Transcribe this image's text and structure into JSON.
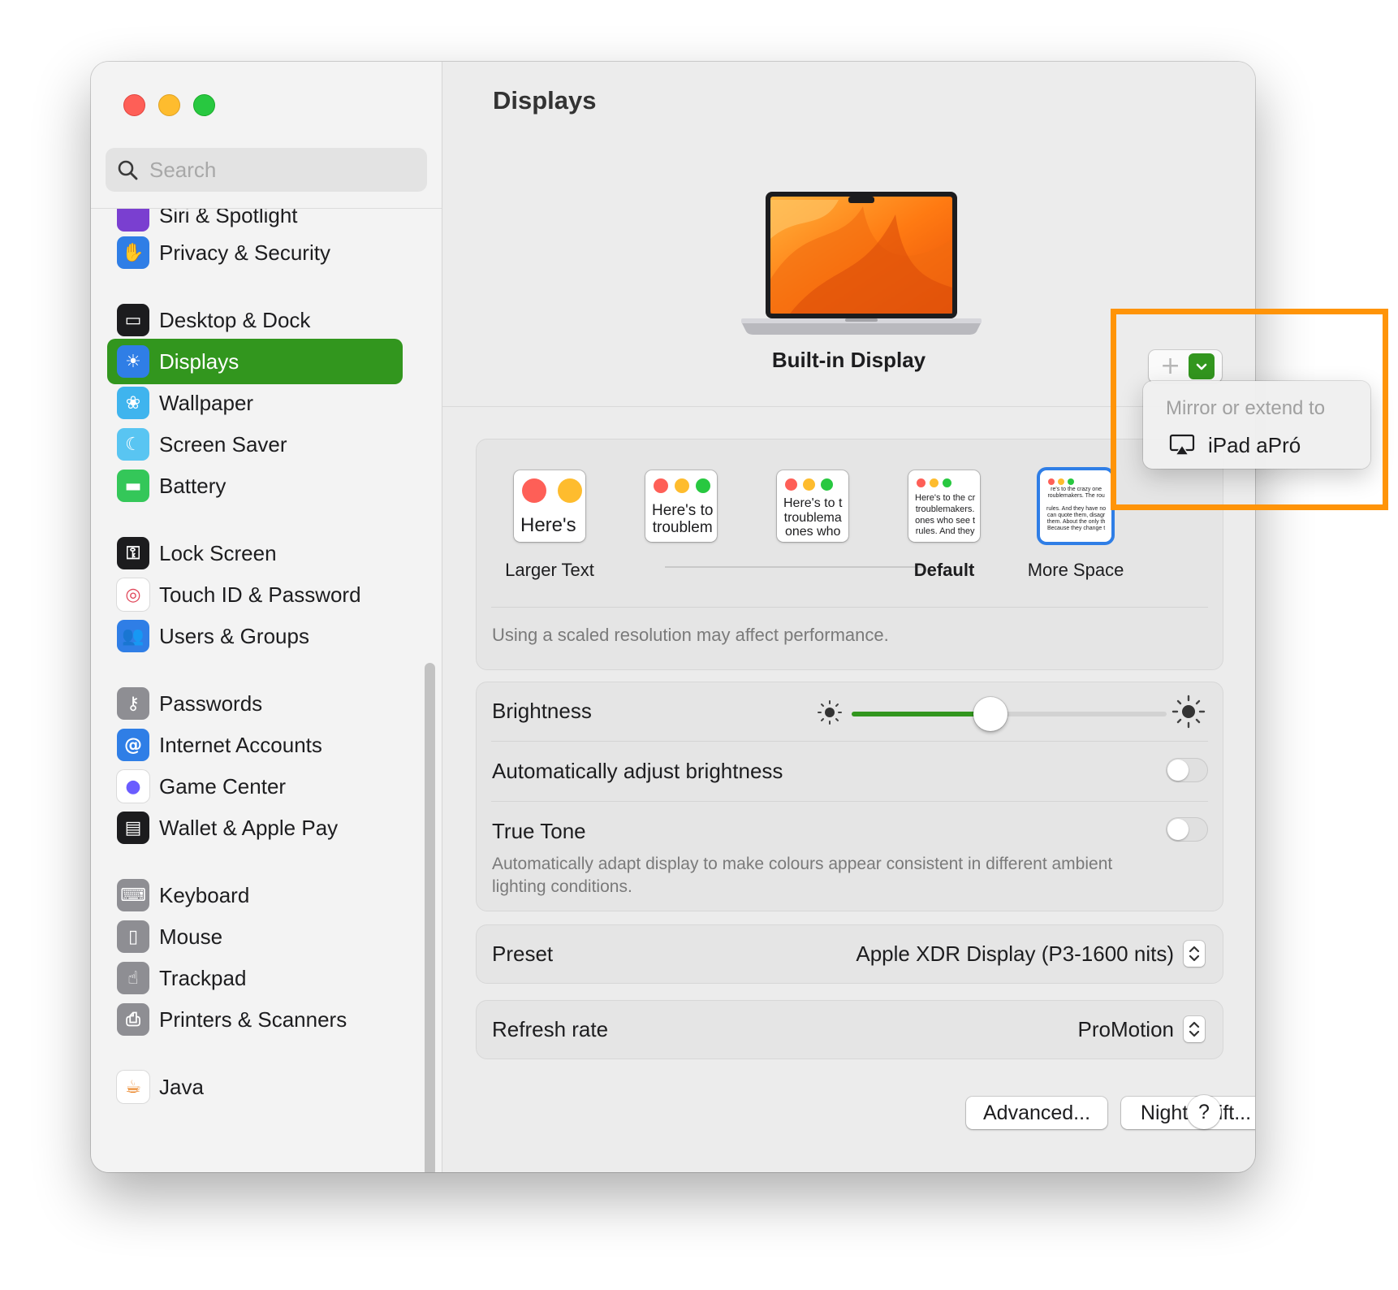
{
  "window": {
    "title": "Displays"
  },
  "sidebar": {
    "search_placeholder": "Search",
    "items": [
      {
        "label": "Siri & Spotlight",
        "icon": "siri-icon",
        "color": "#7a3fd0"
      },
      {
        "label": "Privacy & Security",
        "icon": "hand-icon",
        "color": "#2f7ee6"
      },
      {
        "label": "Desktop & Dock",
        "icon": "dock-icon",
        "color": "#1c1c1e"
      },
      {
        "label": "Displays",
        "icon": "sun-icon",
        "color": "#2f7ee6",
        "selected": true
      },
      {
        "label": "Wallpaper",
        "icon": "flower-icon",
        "color": "#3fb4ee"
      },
      {
        "label": "Screen Saver",
        "icon": "screen-saver-icon",
        "color": "#59c5f2"
      },
      {
        "label": "Battery",
        "icon": "battery-icon",
        "color": "#34c759"
      },
      {
        "label": "Lock Screen",
        "icon": "lock-icon",
        "color": "#1c1c1e"
      },
      {
        "label": "Touch ID & Password",
        "icon": "fingerprint-icon",
        "color": "#ffffff"
      },
      {
        "label": "Users & Groups",
        "icon": "users-icon",
        "color": "#2f7ee6"
      },
      {
        "label": "Passwords",
        "icon": "key-icon",
        "color": "#8e8e93"
      },
      {
        "label": "Internet Accounts",
        "icon": "at-icon",
        "color": "#2f7ee6"
      },
      {
        "label": "Game Center",
        "icon": "game-center-icon",
        "color": "#ffffff"
      },
      {
        "label": "Wallet & Apple Pay",
        "icon": "wallet-icon",
        "color": "#1c1c1e"
      },
      {
        "label": "Keyboard",
        "icon": "keyboard-icon",
        "color": "#8e8e93"
      },
      {
        "label": "Mouse",
        "icon": "mouse-icon",
        "color": "#8e8e93"
      },
      {
        "label": "Trackpad",
        "icon": "trackpad-icon",
        "color": "#8e8e93"
      },
      {
        "label": "Printers & Scanners",
        "icon": "printer-icon",
        "color": "#8e8e93"
      },
      {
        "label": "Java",
        "icon": "java-icon",
        "color": "#ffffff"
      }
    ]
  },
  "main": {
    "title": "Displays",
    "display_name": "Built-in Display",
    "add_button": "+",
    "resolution": {
      "options": [
        {
          "label": "Larger Text",
          "thumb_text": "Here's",
          "selected": false
        },
        {
          "label": "",
          "thumb_text": "Here's to\ntroublem",
          "selected": false
        },
        {
          "label": "",
          "thumb_text": "Here's to t\ntroublema\nones who",
          "selected": false
        },
        {
          "label": "Default",
          "thumb_text": "Here's to the cr\ntroublemakers.\nones who see t\nrules. And they",
          "selected": false
        },
        {
          "label": "More Space",
          "thumb_text": "re's to the crazy one\nroublemakers. The rou\n\nrules. And they have no\ncan quote them, disagr\nthem. About the only th\nBecause they change t",
          "selected": true
        }
      ],
      "note": "Using a scaled resolution may affect performance."
    },
    "brightness": {
      "label": "Brightness",
      "value": 0.44,
      "auto_label": "Automatically adjust brightness",
      "auto_on": false,
      "true_tone_label": "True Tone",
      "true_tone_desc": "Automatically adapt display to make colours appear consistent in different ambient lighting conditions.",
      "true_tone_on": false
    },
    "preset": {
      "label": "Preset",
      "value": "Apple XDR Display (P3-1600 nits)"
    },
    "refresh_rate": {
      "label": "Refresh rate",
      "value": "ProMotion"
    },
    "buttons": {
      "advanced": "Advanced...",
      "night_shift": "Night Shift...",
      "help": "?"
    }
  },
  "menu": {
    "header": "Mirror or extend to",
    "items": [
      {
        "label": "iPad aPró",
        "icon": "airplay-icon"
      }
    ]
  },
  "colors": {
    "accent": "#32961e",
    "highlight": "#ff9408",
    "selection": "#2f7ee6"
  }
}
